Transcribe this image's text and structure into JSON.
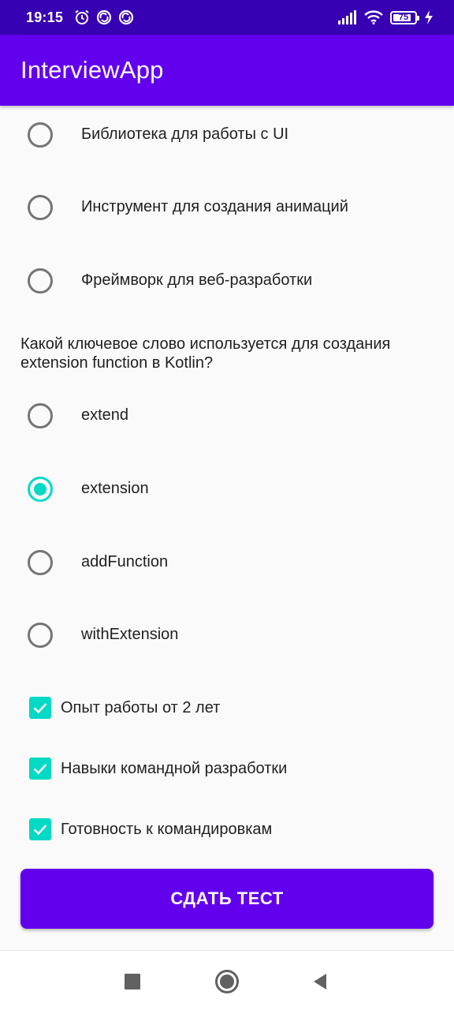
{
  "status_bar": {
    "time": "19:15",
    "battery_level": "75",
    "icons": [
      "alarm-icon",
      "sync-icon",
      "sync-icon",
      "signal-icon",
      "wifi-icon",
      "battery-icon",
      "charging-icon"
    ]
  },
  "app_bar": {
    "title": "InterviewApp"
  },
  "question1": {
    "options": [
      {
        "label": "Библиотека для работы с UI",
        "checked": false
      },
      {
        "label": "Инструмент для создания анимаций",
        "checked": false
      },
      {
        "label": "Фреймворк для веб-разработки",
        "checked": false
      }
    ]
  },
  "question2": {
    "text": "Какой ключевое слово используется для создания extension function в Kotlin?",
    "options": [
      {
        "label": "extend",
        "checked": false
      },
      {
        "label": "extension",
        "checked": true
      },
      {
        "label": "addFunction",
        "checked": false
      },
      {
        "label": "withExtension",
        "checked": false
      }
    ]
  },
  "checkboxes": [
    {
      "label": "Опыт работы от 2 лет",
      "checked": true
    },
    {
      "label": "Навыки командной разработки",
      "checked": true
    },
    {
      "label": "Готовность к командировкам",
      "checked": true
    }
  ],
  "submit_button": {
    "label": "СДАТЬ ТЕСТ"
  },
  "colors": {
    "primary": "#6200EE",
    "primary_dark": "#3700B3",
    "accent": "#03DAC5",
    "background": "#FAFAFA"
  },
  "nav_bar": {
    "buttons": [
      "recents-square-icon",
      "home-circle-icon",
      "back-triangle-icon"
    ]
  }
}
